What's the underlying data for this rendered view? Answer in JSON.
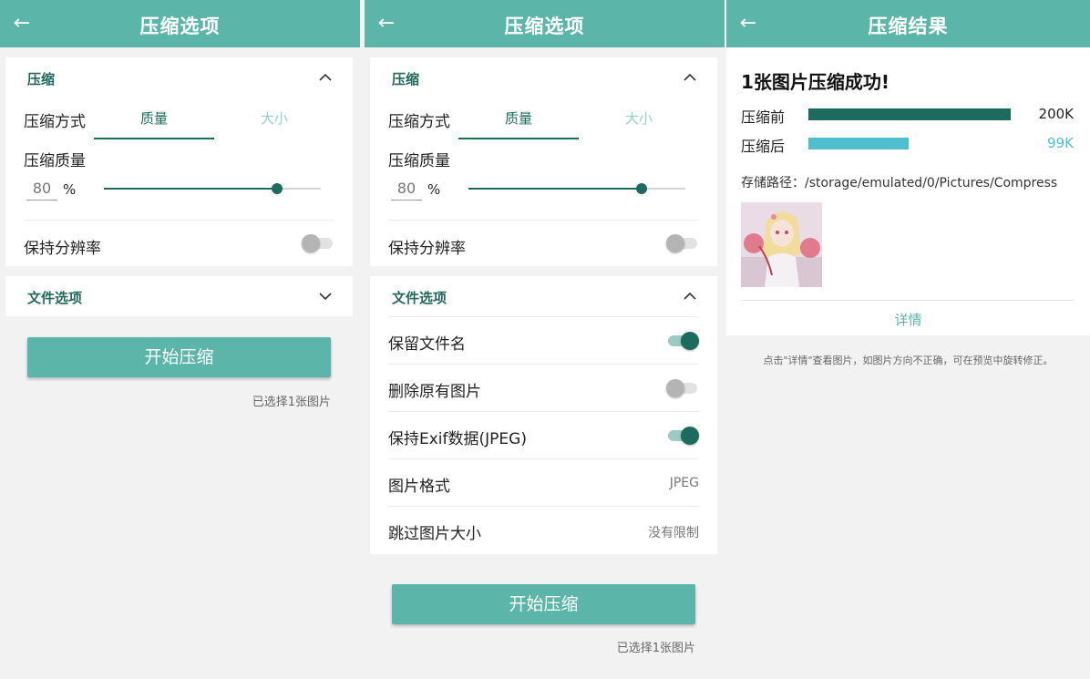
{
  "screen1": {
    "appbar": {
      "title": "压缩选项"
    },
    "compress_section": {
      "title": "压缩",
      "method_label": "压缩方式",
      "method_tabs": [
        "质量",
        "大小"
      ],
      "quality_label": "压缩质量",
      "quality_value": "80",
      "quality_unit": "%",
      "quality_level": 0.8,
      "keep_resolution_label": "保持分辨率",
      "keep_resolution_on": false
    },
    "file_section": {
      "title": "文件选项"
    },
    "start_button": "开始压缩",
    "selected_note": "已选择1张图片"
  },
  "screen2": {
    "appbar": {
      "title": "压缩选项"
    },
    "compress_section": {
      "title": "压缩",
      "method_label": "压缩方式",
      "method_tabs": [
        "质量",
        "大小"
      ],
      "quality_label": "压缩质量",
      "quality_value": "80",
      "quality_unit": "%",
      "quality_level": 0.8,
      "keep_resolution_label": "保持分辨率",
      "keep_resolution_on": false
    },
    "file_section": {
      "title": "文件选项",
      "options": [
        {
          "label": "保留文件名",
          "type": "toggle",
          "on": true
        },
        {
          "label": "删除原有图片",
          "type": "toggle",
          "on": false
        },
        {
          "label": "保持Exif数据(JPEG)",
          "type": "toggle",
          "on": true
        },
        {
          "label": "图片格式",
          "type": "value",
          "value": "JPEG"
        },
        {
          "label": "跳过图片大小",
          "type": "value",
          "value": "没有限制"
        }
      ]
    },
    "start_button": "开始压缩",
    "selected_note": "已选择1张图片"
  },
  "screen3": {
    "appbar": {
      "title": "压缩结果"
    },
    "result_title": "1张图片压缩成功!",
    "before": {
      "label": "压缩前",
      "size": "200K",
      "color": "#1d6b5e",
      "fraction": 1.0
    },
    "after": {
      "label": "压缩后",
      "size": "99K",
      "color": "#4fbfcf",
      "fraction": 0.495
    },
    "path": "存储路径：/storage/emulated/0/Pictures/Compress",
    "detail_link": "详情",
    "hint": "点击\"详情\"查看图片，如图片方向不正确，可在预览中旋转修正。"
  },
  "colors": {
    "accent": "#5bb5a8",
    "primary_dark": "#1d6b5e",
    "after_bar": "#4fbfcf"
  },
  "icons": {
    "back": "arrow-left-icon",
    "chevron_up": "chevron-up-icon",
    "chevron_down": "chevron-down-icon"
  }
}
